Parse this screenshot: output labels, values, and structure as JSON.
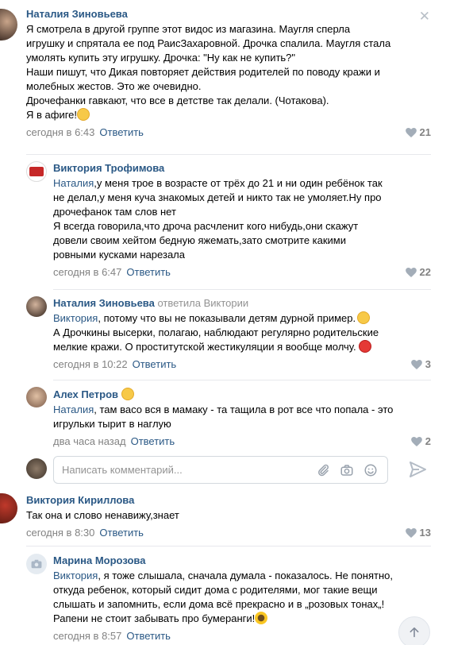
{
  "comments": [
    {
      "author": "Наталия Зиновьева",
      "lines": [
        "Я смотрела в другой группе этот видос из магазина. Маугля сперла",
        "игрушку и спрятала ее под РаисЗахаровной. Дрочка спалила. Маугля стала",
        "умолять купить эту игрушку. Дрочка: \"Ну как не купить?\"",
        "Наши пишут, что Дикая повторяет действия родителей по поводу кражи и",
        "молебных жестов. Это же очевидно.",
        "Дрочефанки гавкают, что все в детстве так делали. (Чотакова).",
        "Я в афиге!"
      ],
      "time": "сегодня в 6:43",
      "reply_label": "Ответить",
      "likes": "21",
      "emoji": "flushed-face"
    },
    {
      "author": "Виктория Трофимова",
      "mention": "Наталия",
      "lines": [
        ",у меня трое в возрасте от трёх до 21 и ни один ребёнок так",
        "не делал,у меня куча знакомых детей и никто так не умоляет.Ну про",
        "дрочефанок там слов нет",
        "Я всегда говорила,что дроча расчленит кого нибудь,они скажут",
        "довели своим хейтом бедную яжемать,зато смотрите какими",
        "ровными кусками нарезала"
      ],
      "time": "сегодня в 6:47",
      "reply_label": "Ответить",
      "likes": "22"
    },
    {
      "author": "Наталия Зиновьева",
      "replied_to": "ответила Виктории",
      "mention": "Виктория",
      "lines": [
        ", потому что вы не показывали детям дурной пример.",
        "А Дрочкины высерки, полагаю, наблюдают регулярно родительские",
        "мелкие кражи. О проститутской жестикуляции я вообще молчу."
      ],
      "time": "сегодня в 10:22",
      "reply_label": "Ответить",
      "likes": "3",
      "emoji": "grinning-sweat-face",
      "emoji2": "angry-face"
    },
    {
      "author": "Алех Петров",
      "mention": "Наталия",
      "lines": [
        ", там васо вся в мамаку - та тащила в рот все что попала - это",
        "игрульки тырит в наглую"
      ],
      "time": "два часа назад",
      "reply_label": "Ответить",
      "likes": "2",
      "name_emoji": "smiling-face"
    },
    {
      "author": "Виктория Кириллова",
      "lines": [
        "Так она и слово ненавижу,знает"
      ],
      "time": "сегодня в 8:30",
      "reply_label": "Ответить",
      "likes": "13"
    },
    {
      "author": "Марина Морозова",
      "mention": "Виктория",
      "lines": [
        ", я тоже слышала, сначала думала - показалось. Не понятно,",
        "откуда ребенок, который сидит дома с родителями, мог такие вещи",
        "слышать и запомнить, если дома всё прекрасно и в „розовых тонах„!",
        "Рапени не стоит забывать про бумеранги!"
      ],
      "time": "сегодня в 8:57",
      "reply_label": "Ответить",
      "emoji": "sunflower"
    }
  ],
  "composer": {
    "placeholder": "Написать комментарий..."
  },
  "icons": [
    "close-icon",
    "heart-icon",
    "paperclip-icon",
    "camera-icon",
    "smiley-icon",
    "send-icon",
    "arrow-up-icon"
  ],
  "colors": {
    "link": "#2a5885",
    "meta": "#828282",
    "divider": "#e7e8ec"
  }
}
